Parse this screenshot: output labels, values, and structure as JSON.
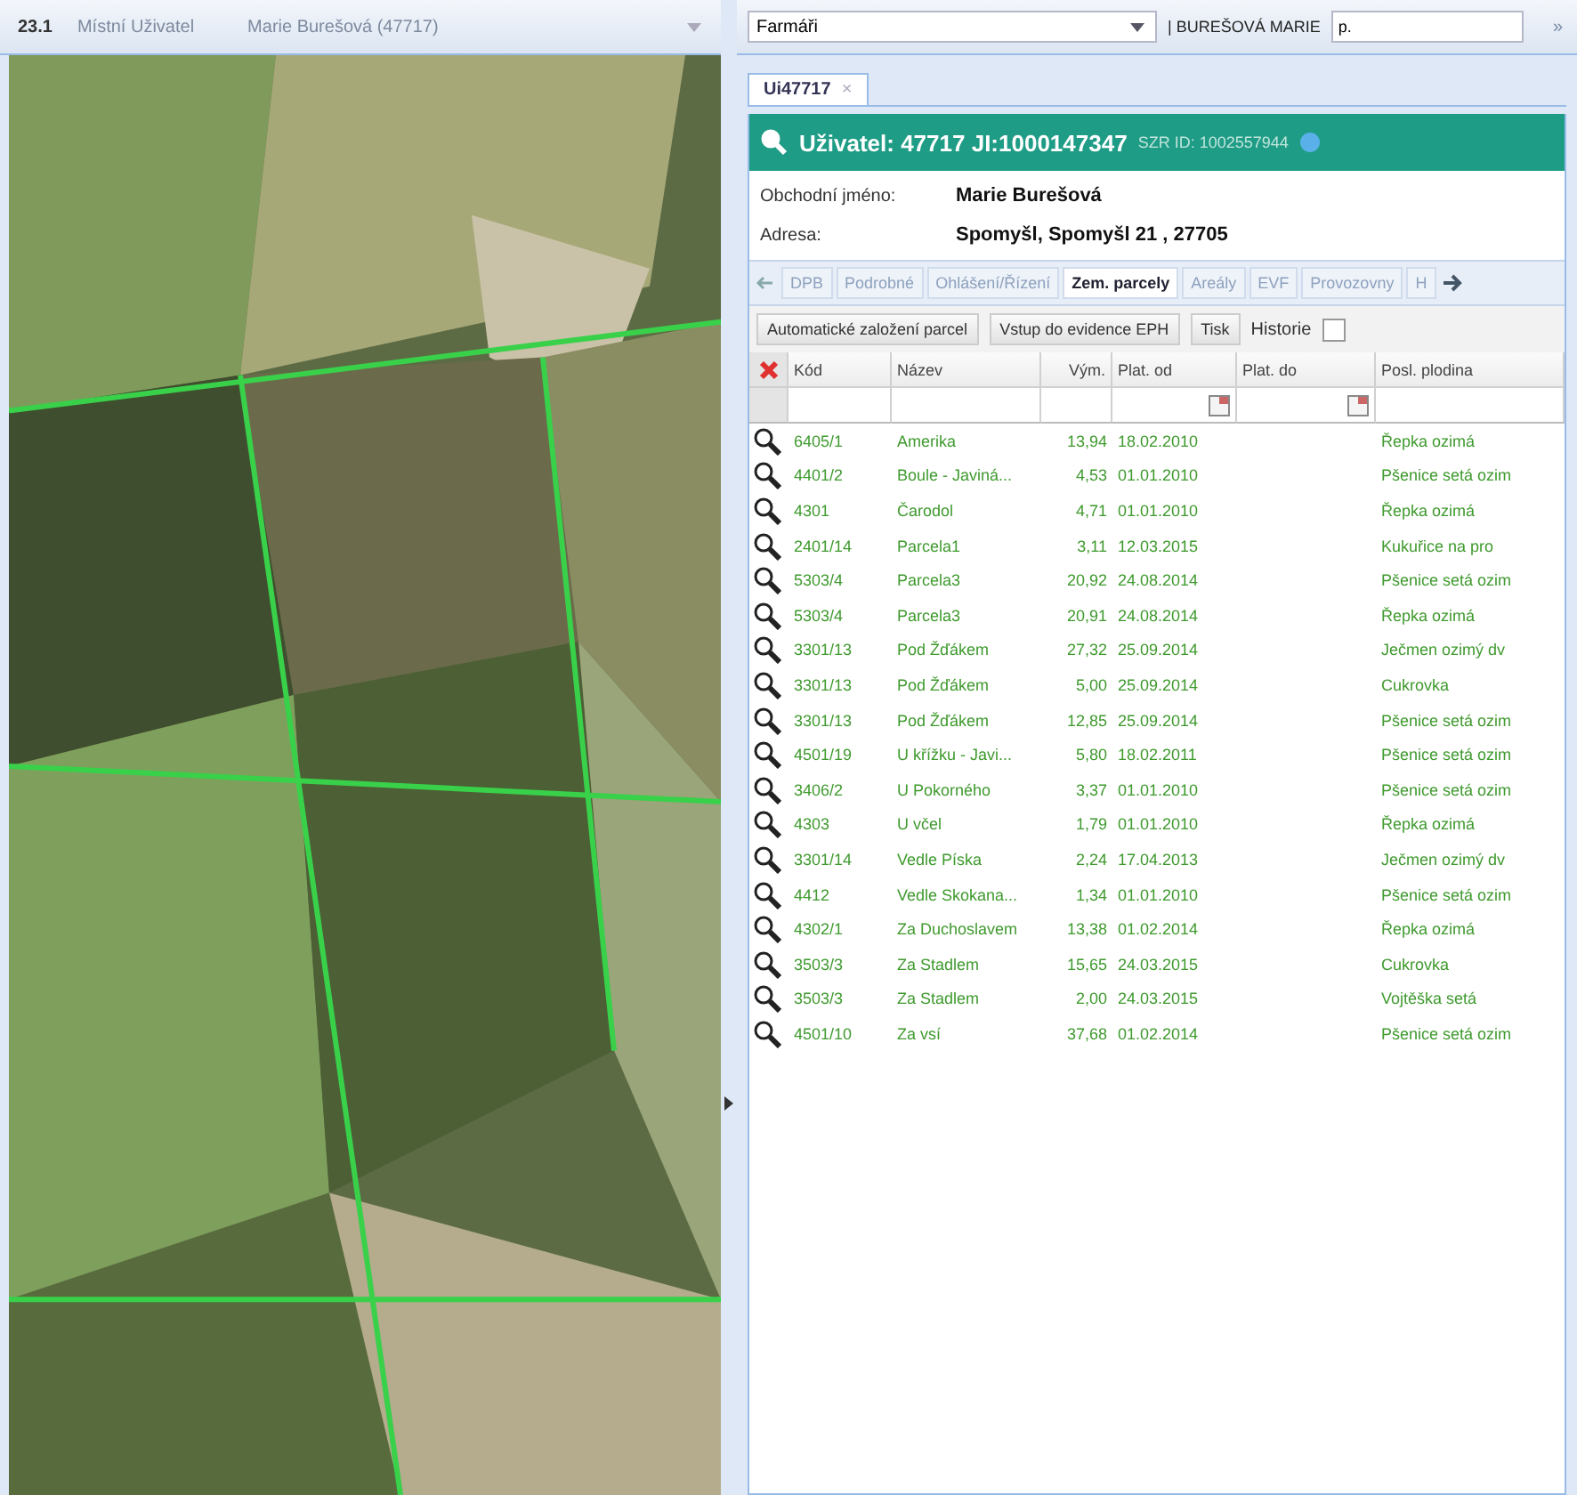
{
  "map_panel": {
    "version": "23.1",
    "user_type": "Místní Uživatel",
    "user": "Marie Burešová (47717)"
  },
  "top_bar": {
    "farmer_select": {
      "value": "Farmáři"
    },
    "farmer_name": "| BUREŠOVÁ MARIE",
    "search": {
      "value": "p."
    },
    "expand": "»"
  },
  "document_tabs": [
    {
      "label": "Ui47717",
      "close": "×",
      "selected": true
    }
  ],
  "user_header": {
    "title": "Uživatel: 47717 JI:1000147347",
    "szr_id": "SZR ID: 1002557944"
  },
  "details": [
    {
      "label": "Obchodní jméno:",
      "value": "Marie Burešová"
    },
    {
      "label": "Adresa:",
      "value": "Spomyšl, Spomyšl 21 , 27705"
    }
  ],
  "tabs": [
    {
      "label": "DPB",
      "selected": false
    },
    {
      "label": "Podrobné",
      "selected": false
    },
    {
      "label": "Ohlášení/Řízení",
      "selected": false
    },
    {
      "label": "Zem. parcely",
      "selected": true
    },
    {
      "label": "Areály",
      "selected": false
    },
    {
      "label": "EVF",
      "selected": false
    },
    {
      "label": "Provozovny",
      "selected": false
    },
    {
      "label": "H",
      "selected": false
    }
  ],
  "toolbar": {
    "buttons": [
      "Automatické založení parcel",
      "Vstup do evidence EPH",
      "Tisk"
    ],
    "history": {
      "label": "Historie",
      "checked": false
    }
  },
  "table": {
    "columns": [
      "Kód",
      "Název",
      "Vým.",
      "Plat. od",
      "Plat. do",
      "Posl. plodina"
    ],
    "rows": [
      [
        "6405/1",
        "Amerika",
        "13,94",
        "18.02.2010",
        "",
        "Řepka ozimá"
      ],
      [
        "4401/2",
        "Boule - Javiná...",
        "4,53",
        "01.01.2010",
        "",
        "Pšenice setá ozim"
      ],
      [
        "4301",
        "Čarodol",
        "4,71",
        "01.01.2010",
        "",
        "Řepka ozimá"
      ],
      [
        "2401/14",
        "Parcela1",
        "3,11",
        "12.03.2015",
        "",
        "Kukuřice na pro"
      ],
      [
        "5303/4",
        "Parcela3",
        "20,92",
        "24.08.2014",
        "",
        "Pšenice setá ozim"
      ],
      [
        "5303/4",
        "Parcela3",
        "20,91",
        "24.08.2014",
        "",
        "Řepka ozimá"
      ],
      [
        "3301/13",
        "Pod Žďákem",
        "27,32",
        "25.09.2014",
        "",
        "Ječmen ozimý dv"
      ],
      [
        "3301/13",
        "Pod Žďákem",
        "5,00",
        "25.09.2014",
        "",
        "Cukrovka"
      ],
      [
        "3301/13",
        "Pod Žďákem",
        "12,85",
        "25.09.2014",
        "",
        "Pšenice setá ozim"
      ],
      [
        "4501/19",
        "U křížku - Javi...",
        "5,80",
        "18.02.2011",
        "",
        "Pšenice setá ozim"
      ],
      [
        "3406/2",
        "U Pokorného",
        "3,37",
        "01.01.2010",
        "",
        "Pšenice setá ozim"
      ],
      [
        "4303",
        "U včel",
        "1,79",
        "01.01.2010",
        "",
        "Řepka ozimá"
      ],
      [
        "3301/14",
        "Vedle Píska",
        "2,24",
        "17.04.2013",
        "",
        "Ječmen ozimý dv"
      ],
      [
        "4412",
        "Vedle Skokana...",
        "1,34",
        "01.01.2010",
        "",
        "Pšenice setá ozim"
      ],
      [
        "4302/1",
        "Za Duchoslavem",
        "13,38",
        "01.02.2014",
        "",
        "Řepka ozimá"
      ],
      [
        "3503/3",
        "Za Stadlem",
        "15,65",
        "24.03.2015",
        "",
        "Cukrovka"
      ],
      [
        "3503/3",
        "Za Stadlem",
        "2,00",
        "24.03.2015",
        "",
        "Vojtěška setá"
      ],
      [
        "4501/10",
        "Za vsí",
        "37,68",
        "01.02.2014",
        "",
        "Pšenice setá ozim"
      ]
    ]
  }
}
